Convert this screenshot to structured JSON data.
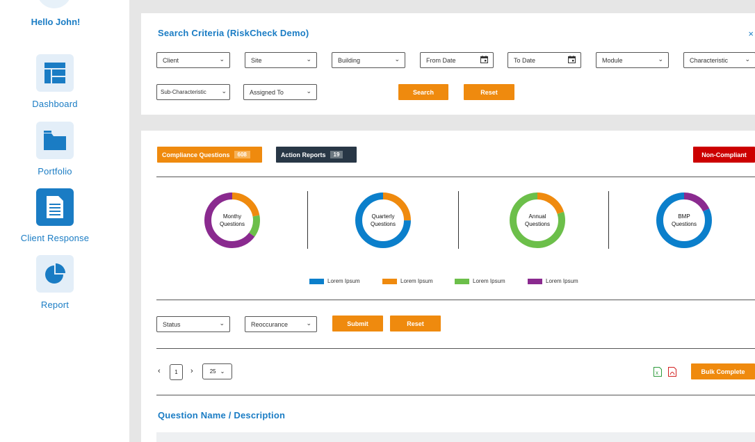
{
  "sidebar": {
    "greeting": "Hello John!",
    "items": [
      {
        "label": "Dashboard",
        "icon": "dashboard-icon"
      },
      {
        "label": "Portfolio",
        "icon": "folder-icon"
      },
      {
        "label": "Client Response",
        "icon": "document-icon"
      },
      {
        "label": "Report",
        "icon": "pie-chart-icon"
      }
    ],
    "active_item": "Client Response"
  },
  "search": {
    "title": "Search Criteria (RiskCheck Demo)",
    "close": "×",
    "fields": {
      "client": "Client",
      "site": "Site",
      "building": "Building",
      "from_date": "From Date",
      "to_date": "To Date",
      "module": "Module",
      "characteristic": "Characteristic",
      "sub_characteristic": "Sub-Characteristic",
      "assigned_to": "Assigned To"
    },
    "search_label": "Search",
    "reset_label": "Reset"
  },
  "tags": {
    "compliance_label": "Compliance Questions",
    "compliance_count": "608",
    "action_label": "Action Reports",
    "action_count": "19",
    "noncompliant_label": "Non-Compliant"
  },
  "donuts": [
    {
      "line1": "Monthy",
      "line2": "Questions",
      "segments": [
        {
          "color": "orange",
          "fraction": 0.22
        },
        {
          "color": "green",
          "fraction": 0.13
        },
        {
          "color": "purple",
          "fraction": 0.65
        }
      ]
    },
    {
      "line1": "Quarterly",
      "line2": "Questions",
      "segments": [
        {
          "color": "orange",
          "fraction": 0.25
        },
        {
          "color": "blue",
          "fraction": 0.75
        }
      ]
    },
    {
      "line1": "Annual",
      "line2": "Questions",
      "segments": [
        {
          "color": "orange",
          "fraction": 0.2
        },
        {
          "color": "green",
          "fraction": 0.8
        }
      ]
    },
    {
      "line1": "BMP",
      "line2": "Questions",
      "segments": [
        {
          "color": "purple",
          "fraction": 0.18
        },
        {
          "color": "blue",
          "fraction": 0.82
        }
      ]
    }
  ],
  "legend": [
    {
      "label": "Lorem Ipsum",
      "color": "blue"
    },
    {
      "label": "Lorem Ipsum",
      "color": "orange"
    },
    {
      "label": "Lorem Ipsum",
      "color": "green"
    },
    {
      "label": "Lorem Ipsum",
      "color": "purple"
    }
  ],
  "colors": {
    "blue": "#0b7fcb",
    "orange": "#ef8a0e",
    "green": "#6cbf4a",
    "purple": "#8a2a8f",
    "accent": "#1a7cc4",
    "danger": "#cc0000"
  },
  "filters": {
    "status": "Status",
    "reoccurance": "Reoccurance",
    "submit_label": "Submit",
    "reset_label": "Reset"
  },
  "pager": {
    "prev": "‹",
    "page": "1",
    "next": "›",
    "page_size": "25",
    "bulk_label": "Bulk Complete"
  },
  "questions": {
    "title": "Question Name / Description"
  }
}
